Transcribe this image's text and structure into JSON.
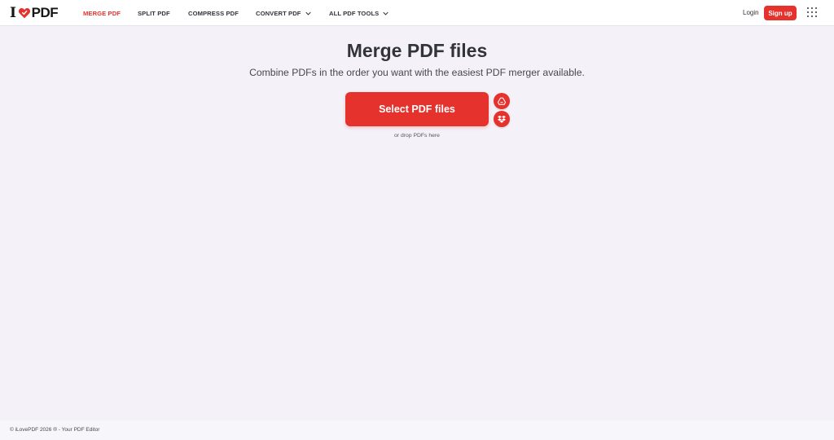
{
  "header": {
    "logo": {
      "prefix": "I",
      "suffix": "PDF",
      "brand_color": "#e5322d"
    },
    "nav": [
      {
        "label": "MERGE PDF",
        "active": true
      },
      {
        "label": "SPLIT PDF",
        "active": false
      },
      {
        "label": "COMPRESS PDF",
        "active": false
      },
      {
        "label": "CONVERT PDF",
        "active": false,
        "dropdown": true
      },
      {
        "label": "ALL PDF TOOLS",
        "active": false,
        "dropdown": true
      }
    ],
    "login_label": "Login",
    "signup_label": "Sign up",
    "apps_icon": "grid-dots-icon"
  },
  "main": {
    "title": "Merge PDF files",
    "subtitle": "Combine PDFs in the order you want with the easiest PDF merger available.",
    "select_button_label": "Select PDF files",
    "cloud_buttons": [
      {
        "icon": "google-drive-icon"
      },
      {
        "icon": "dropbox-icon"
      }
    ],
    "drop_hint": "or drop PDFs here"
  },
  "footer": {
    "text": "© iLovePDF 2026 ® - Your PDF Editor"
  },
  "colors": {
    "accent": "#e5322d",
    "background": "#f4f2f8",
    "text": "#33333b"
  }
}
